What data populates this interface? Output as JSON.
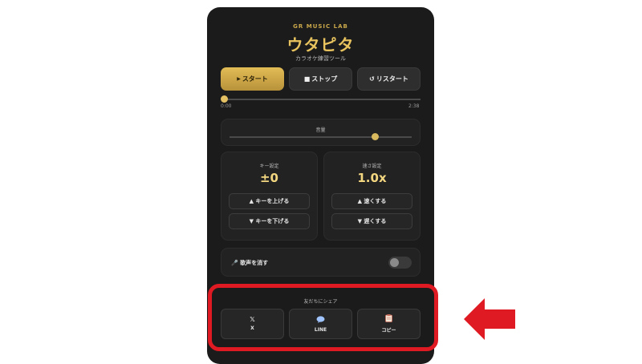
{
  "app": {
    "brand": "GR MUSIC LAB",
    "title": "ウタピタ",
    "subtitle": "カラオケ練習ツール"
  },
  "controls": {
    "start_label": "スタート",
    "stop_label": "ストップ",
    "restart_label": "リスタート"
  },
  "progress": {
    "current": "0:00",
    "total": "2:38",
    "fraction": 0.0
  },
  "volume": {
    "label": "音量",
    "fraction": 0.8
  },
  "key": {
    "label": "キー設定",
    "value": "±0",
    "up_label": "キーを上げる",
    "down_label": "キーを下げる"
  },
  "speed": {
    "label": "速さ設定",
    "value": "1.0x",
    "up_label": "速くする",
    "down_label": "遅くする"
  },
  "vocal": {
    "label": "歌声を消す",
    "enabled": false
  },
  "share": {
    "label": "友だちにシェア",
    "buttons": [
      {
        "icon": "x-logo-icon",
        "label": "X"
      },
      {
        "icon": "speech-bubble-icon",
        "label": "LINE"
      },
      {
        "icon": "clipboard-icon",
        "label": "コピー"
      }
    ]
  },
  "colors": {
    "accent": "#e2bc55",
    "highlight": "#e01a22",
    "background": "#1b1b1b"
  }
}
